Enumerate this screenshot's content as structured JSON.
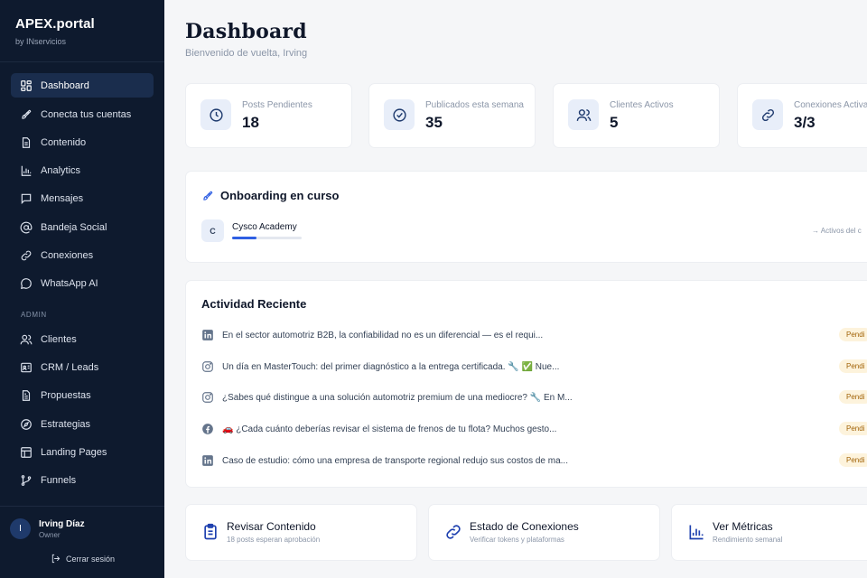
{
  "brand": {
    "name": "APEX.portal",
    "sub": "by INservicios"
  },
  "nav": {
    "items": [
      {
        "label": "Dashboard"
      },
      {
        "label": "Conecta tus cuentas"
      },
      {
        "label": "Contenido"
      },
      {
        "label": "Analytics"
      },
      {
        "label": "Mensajes"
      },
      {
        "label": "Bandeja Social"
      },
      {
        "label": "Conexiones"
      },
      {
        "label": "WhatsApp AI"
      }
    ],
    "admin_label": "ADMIN",
    "admin_items": [
      {
        "label": "Clientes"
      },
      {
        "label": "CRM / Leads"
      },
      {
        "label": "Propuestas"
      },
      {
        "label": "Estrategias"
      },
      {
        "label": "Landing Pages"
      },
      {
        "label": "Funnels"
      }
    ]
  },
  "user": {
    "initial": "I",
    "name": "Irving Díaz",
    "role": "Owner",
    "logout": "Cerrar sesión"
  },
  "header": {
    "title": "Dashboard",
    "subtitle": "Bienvenido de vuelta, Irving"
  },
  "stats": [
    {
      "label": "Posts Pendientes",
      "value": "18",
      "icon": "clock-icon"
    },
    {
      "label": "Publicados esta semana",
      "value": "35",
      "icon": "check-circle-icon"
    },
    {
      "label": "Clientes Activos",
      "value": "5",
      "icon": "users-icon"
    },
    {
      "label": "Conexiones Activas",
      "value": "3/3",
      "icon": "link-icon"
    }
  ],
  "onboarding": {
    "title": "Onboarding en curso",
    "client_initial": "C",
    "client_name": "Cysco Academy",
    "progress": 0.35,
    "link": "Activos del c"
  },
  "activity": {
    "title": "Actividad Reciente",
    "items": [
      {
        "platform": "linkedin-icon",
        "text": "En el sector automotriz B2B, la confiabilidad no es un diferencial — es el requi...",
        "status": "Pendi"
      },
      {
        "platform": "instagram-icon",
        "text": "Un día en MasterTouch: del primer diagnóstico a la entrega certificada. 🔧 ✅ Nue...",
        "status": "Pendi"
      },
      {
        "platform": "instagram-icon",
        "text": "¿Sabes qué distingue a una solución automotriz premium de una mediocre? 🔧 En M...",
        "status": "Pendi"
      },
      {
        "platform": "facebook-icon",
        "text": "🚗 ¿Cada cuánto deberías revisar el sistema de frenos de tu flota? Muchos gesto...",
        "status": "Pendi"
      },
      {
        "platform": "linkedin-icon",
        "text": "Caso de estudio: cómo una empresa de transporte regional redujo sus costos de ma...",
        "status": "Pendi"
      }
    ]
  },
  "actions": [
    {
      "title": "Revisar Contenido",
      "sub": "18 posts esperan aprobación",
      "icon": "clipboard-icon"
    },
    {
      "title": "Estado de Conexiones",
      "sub": "Verificar tokens y plataformas",
      "icon": "link-icon"
    },
    {
      "title": "Ver Métricas",
      "sub": "Rendimiento semanal",
      "icon": "bar-chart-icon"
    }
  ],
  "colors": {
    "sidebar_bg": "#0e1a2e",
    "accent": "#2f5fe3",
    "status_bg": "#fdf3dc"
  }
}
